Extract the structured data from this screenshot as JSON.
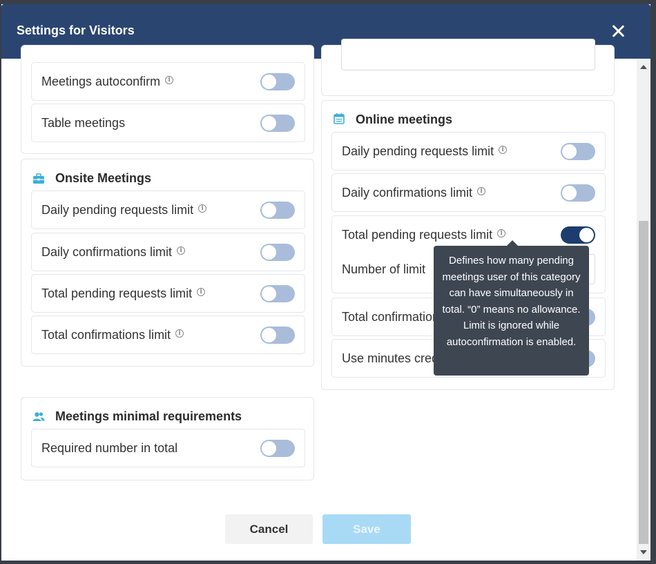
{
  "modal": {
    "title": "Settings for Visitors"
  },
  "top_panel": {
    "rows": [
      {
        "label": "Meetings autoconfirm",
        "info": true,
        "on": false
      },
      {
        "label": "Table meetings",
        "info": false,
        "on": false
      }
    ]
  },
  "onsite": {
    "title": "Onsite Meetings",
    "icon": "briefcase-icon",
    "rows": [
      {
        "label": "Daily pending requests limit",
        "on": false
      },
      {
        "label": "Daily confirmations limit",
        "on": false
      },
      {
        "label": "Total pending requests limit",
        "on": false
      },
      {
        "label": "Total confirmations limit",
        "on": false
      }
    ]
  },
  "requirements": {
    "title": "Meetings minimal requirements",
    "icon": "users-icon",
    "rows": [
      {
        "label": "Required number in total",
        "on": false
      }
    ]
  },
  "online": {
    "title": "Online meetings",
    "icon": "calendar-icon",
    "rows": [
      {
        "label": "Daily pending requests limit",
        "on": false
      },
      {
        "label": "Daily confirmations limit",
        "on": false
      },
      {
        "label": "Total pending requests limit",
        "on": true,
        "sub_label": "Number of limit"
      },
      {
        "label": "Total confirmation",
        "on": false
      },
      {
        "label": "Use minutes credit",
        "on": false
      }
    ]
  },
  "tooltip": {
    "text": "Defines how many pending meetings user of this category can have simultaneously in total. “0” means no allowance. Limit is ignored while autoconfirmation is enabled."
  },
  "footer": {
    "cancel_label": "Cancel",
    "save_label": "Save"
  },
  "colors": {
    "header": "#2b4571",
    "toggle_off": "#a9bcda",
    "toggle_on": "#1c3d6e",
    "icon_accent": "#3bb0d9",
    "save_disabled": "#a8daf6"
  }
}
